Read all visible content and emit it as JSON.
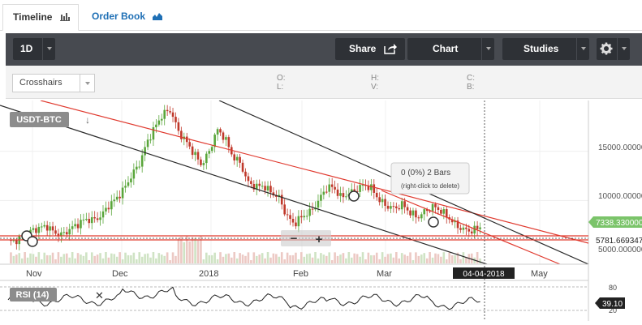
{
  "tabs": [
    {
      "label": "Timeline",
      "icon": "bar-chart-icon"
    },
    {
      "label": "Order Book",
      "icon": "area-chart-icon"
    }
  ],
  "toolbar": {
    "period": "1D",
    "share": "Share",
    "chart": "Chart",
    "studies": "Studies",
    "settings_icon": "gear-icon"
  },
  "subbar": {
    "drawing_tool": "Crosshairs",
    "o_label": "O:",
    "l_label": "L:",
    "h_label": "H:",
    "v_label": "V:",
    "c_label": "C:",
    "b_label": "B:"
  },
  "chart": {
    "symbol": "USDT-BTC",
    "x_ticks": [
      "Nov",
      "Dec",
      "2018",
      "Feb",
      "Mar",
      "May"
    ],
    "y_ticks": [
      "15000.000000",
      "10000.000000",
      "5000.000000"
    ],
    "current_price": "7338.330000",
    "line_price": "5781.669347",
    "cursor_date": "04-04-2018",
    "tooltip_line1": "0 (0%) 2 Bars",
    "tooltip_line2": "(right-click to delete)",
    "zoom_out": "−",
    "zoom_in": "+",
    "colors": {
      "up": "#5aa63b",
      "down": "#c0392b",
      "trend_red": "#e03a2f",
      "trend_black": "#2b2b2b",
      "price_badge": "#7bc46a"
    }
  },
  "rsi": {
    "label": "RSI (14)",
    "ticks": [
      "80",
      "20"
    ],
    "value": "39.10"
  },
  "chart_data": {
    "type": "line",
    "title": "",
    "series": [
      {
        "values": [
          5800,
          5900,
          6400,
          6900,
          7200,
          7400,
          6700,
          6500,
          7100,
          7600,
          8100,
          8000,
          8400,
          9500,
          10200,
          11200,
          12600,
          13800,
          16000,
          17500,
          18800,
          19200,
          17000,
          16000,
          14800,
          13600,
          15000,
          17200,
          16400,
          14500,
          13800,
          11800,
          11400,
          11500,
          10800,
          10300,
          8400,
          7600,
          8400,
          8800,
          9800,
          11200,
          11400,
          10300,
          10700,
          11100,
          11600,
          11200,
          10000,
          9400,
          9200,
          9600,
          8700,
          8300,
          9000,
          9400,
          8900,
          8200,
          7400,
          7000,
          6900,
          7338
        ]
      }
    ],
    "ylim": [
      5000,
      20000
    ]
  }
}
